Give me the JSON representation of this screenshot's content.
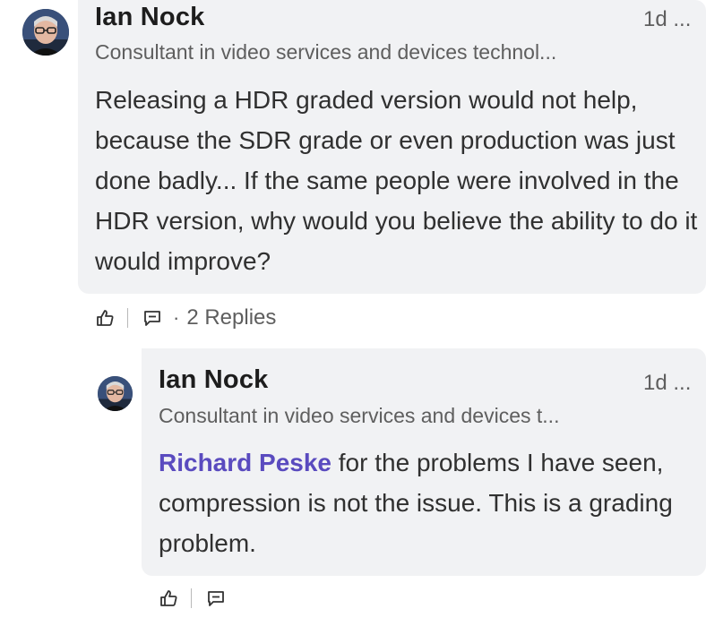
{
  "comment": {
    "author": "Ian Nock",
    "headline": "Consultant in video services and devices technol...",
    "time": "1d ...",
    "text": "Releasing a HDR graded version would not help, because the SDR grade or even production was just done badly... If the same people were involved in the HDR version, why would you believe the ability to do it would improve?",
    "replies_separator": "·",
    "replies_label": "2 Replies"
  },
  "reply": {
    "author": "Ian Nock",
    "headline": "Consultant in video services and devices t...",
    "time": "1d ...",
    "mention": "Richard Peske",
    "text": " for the problems I have seen, compression is not the issue. This is a grading problem."
  },
  "colors": {
    "bubble": "#f1f2f4",
    "mention": "#5a4bbf",
    "muted": "#5e5e5e"
  },
  "icons": {
    "like": "thumbs-up-icon",
    "reply": "comment-icon"
  }
}
